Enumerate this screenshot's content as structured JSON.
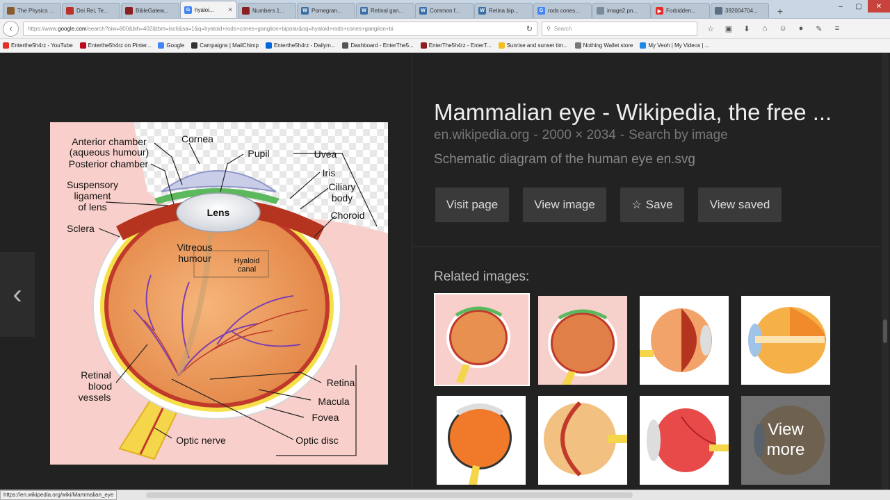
{
  "tabs": [
    {
      "label": "The Physics of...",
      "color": "#8a5a2b",
      "glyph": ""
    },
    {
      "label": "Dei Rei, Te...",
      "color": "#b8322a",
      "glyph": ""
    },
    {
      "label": "BibleGatew...",
      "color": "#8b1e1e",
      "glyph": ""
    },
    {
      "label": "hyaloi...",
      "color": "#4285f4",
      "glyph": "G",
      "active": true
    },
    {
      "label": "Numbers 1...",
      "color": "#8b1e1e",
      "glyph": ""
    },
    {
      "label": "Pomegran...",
      "color": "#3a6ea5",
      "glyph": "W"
    },
    {
      "label": "Retinal gan...",
      "color": "#3a6ea5",
      "glyph": "W"
    },
    {
      "label": "Common f...",
      "color": "#3a6ea5",
      "glyph": "W"
    },
    {
      "label": "Retina bip...",
      "color": "#3a6ea5",
      "glyph": "W"
    },
    {
      "label": "rods cones...",
      "color": "#4285f4",
      "glyph": "G"
    },
    {
      "label": "image2.pn...",
      "color": "#7a8a99",
      "glyph": ""
    },
    {
      "label": "Forbidden...",
      "color": "#e52d27",
      "glyph": "▶"
    },
    {
      "label": "392004704...",
      "color": "#5b6e82",
      "glyph": ""
    }
  ],
  "window_controls": {
    "minimize": "–",
    "restore": "▢",
    "close": "✕"
  },
  "nav": {
    "back_glyph": "‹",
    "url_prefix": "https://www.",
    "url_domain": "google.com",
    "url_rest": "/search?biw=800&bih=402&tbm=isch&sa=1&q=hyaloid+rods+cones+ganglion+bipolar&oq=hyaloid+rods+cones+ganglion+bi",
    "reload_glyph": "↻",
    "search_placeholder": "Search",
    "icons": [
      "☆",
      "▣",
      "⬇",
      "⌂",
      "☺",
      "●",
      "✎",
      "≡"
    ]
  },
  "bookmarks": [
    {
      "label": "Enterthe5h4rz - YouTube",
      "color": "#e52d27"
    },
    {
      "label": "Enterthe5h4rz on Pinter...",
      "color": "#bd081c"
    },
    {
      "label": "Google",
      "color": "#4285f4"
    },
    {
      "label": "Campaigns | MailChimp",
      "color": "#333333"
    },
    {
      "label": "Enterthe5h4rz - Dailym...",
      "color": "#0066dc"
    },
    {
      "label": "Dashboard - EnterThe5...",
      "color": "#555555"
    },
    {
      "label": "EnterThe5h4rz - EnterT...",
      "color": "#8b1e1e"
    },
    {
      "label": "Sunrise and sunset tim...",
      "color": "#f0c020"
    },
    {
      "label": "Nothing Wallet store",
      "color": "#777777"
    },
    {
      "label": "My Veoh | My Videos | ...",
      "color": "#1e88e5"
    }
  ],
  "viewer": {
    "prev_glyph": "‹",
    "title": "Mammalian eye - Wikipedia, the free ...",
    "domain": "en.wikipedia.org",
    "dimensions": "2000 × 2034",
    "search_by_image": "Search by image",
    "separator": "-",
    "description": "Schematic diagram of the human eye en.svg",
    "actions": [
      {
        "label": "Visit page",
        "icon": ""
      },
      {
        "label": "View image",
        "icon": ""
      },
      {
        "label": "Save",
        "icon": "☆"
      },
      {
        "label": "View saved",
        "icon": ""
      }
    ],
    "related_label": "Related images:",
    "view_more": [
      "View",
      "more"
    ]
  },
  "diagram_labels": {
    "anterior_chamber": [
      "Anterior chamber",
      "(aqueous humour)"
    ],
    "posterior_chamber": "Posterior chamber",
    "cornea": "Cornea",
    "pupil": "Pupil",
    "uvea": "Uvea",
    "iris": "Iris",
    "ciliary_body": [
      "Ciliary",
      "body"
    ],
    "suspensory": [
      "Suspensory",
      "ligament",
      "of lens"
    ],
    "lens": "Lens",
    "choroid": "Choroid",
    "sclera": "Sclera",
    "vitreous": [
      "Vitreous",
      "humour"
    ],
    "hyaloid": [
      "Hyaloid",
      "canal"
    ],
    "retinal_vessels": [
      "Retinal",
      "blood",
      "vessels"
    ],
    "retina": "Retina",
    "macula": "Macula",
    "fovea": "Fovea",
    "optic_disc": "Optic disc",
    "optic_nerve": "Optic nerve"
  },
  "status": {
    "link": "https://en.wikipedia.org/wiki/Mammalian_eye"
  }
}
